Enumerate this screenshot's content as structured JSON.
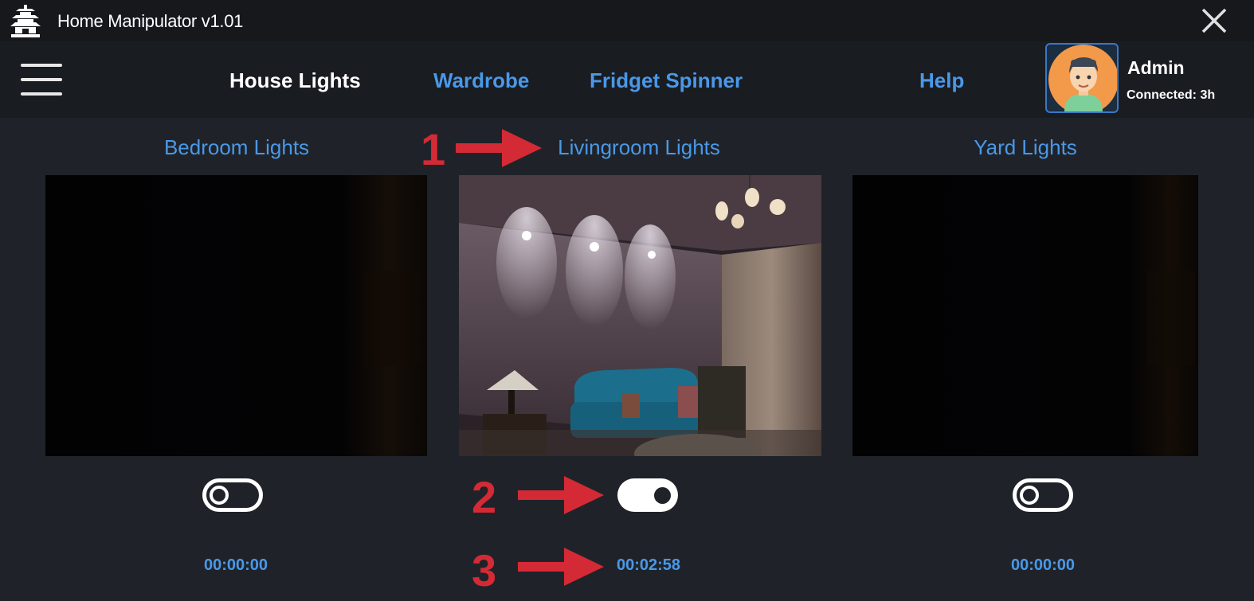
{
  "window": {
    "title": "Home Manipulator v1.01"
  },
  "nav": {
    "items": [
      {
        "label": "House Lights",
        "active": true
      },
      {
        "label": "Wardrobe",
        "active": false
      },
      {
        "label": "Fridget Spinner",
        "active": false
      },
      {
        "label": "Help",
        "active": false
      }
    ]
  },
  "user": {
    "name": "Admin",
    "status": "Connected: 3h"
  },
  "panels": [
    {
      "title": "Bedroom Lights",
      "toggle_on": false,
      "timer": "00:00:00"
    },
    {
      "title": "Livingroom Lights",
      "toggle_on": true,
      "timer": "00:02:58"
    },
    {
      "title": "Yard Lights",
      "toggle_on": false,
      "timer": "00:00:00"
    }
  ],
  "annotations": [
    "1",
    "2",
    "3"
  ],
  "colors": {
    "accent": "#4a98e8",
    "annotation": "#d42a35",
    "background": "#1f2329"
  },
  "icons": [
    "pagoda-icon",
    "close-icon",
    "hamburger-menu-icon",
    "toggle-switch-icon"
  ]
}
